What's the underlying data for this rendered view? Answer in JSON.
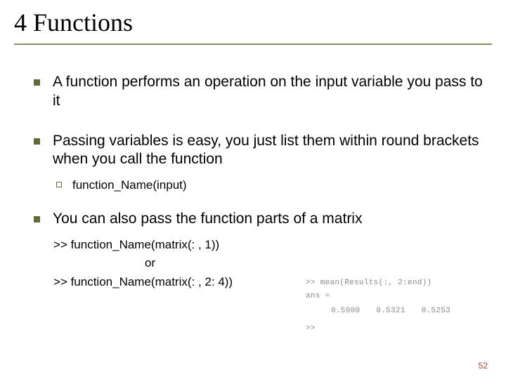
{
  "title": "4 Functions",
  "bullets": {
    "b1": "A function performs an operation on the input variable you pass to it",
    "b2": "Passing variables is easy, you just list them within round brackets when you call the function",
    "b2_sub": "function_Name(input)",
    "b3": "You can also pass the function parts of a matrix"
  },
  "code": {
    "line1": ">> function_Name(matrix(: , 1))",
    "line_or": "or",
    "line2": ">> function_Name(matrix(: , 2: 4))"
  },
  "console": {
    "l1": ">> mean(Results(:, 2:end))",
    "l2": "ans =",
    "l3": "0.5900 0.5321 0.5253",
    "l4": ">>"
  },
  "page": "52"
}
